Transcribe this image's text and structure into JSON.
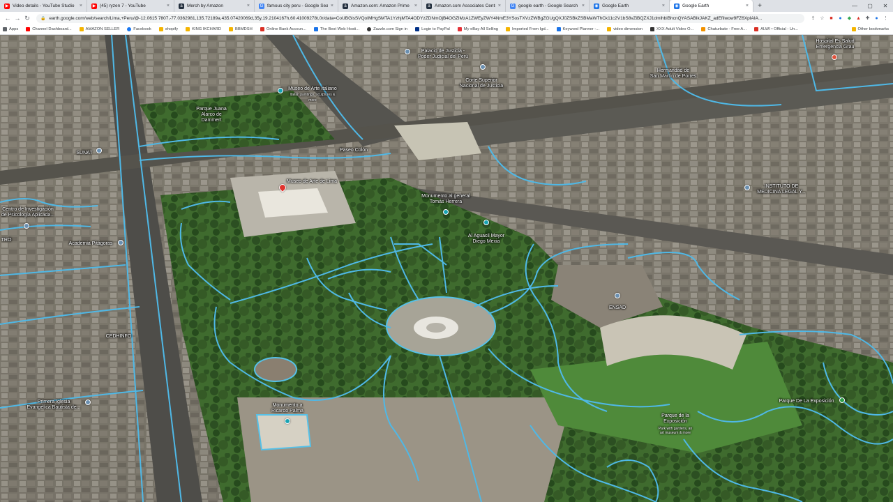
{
  "tabs": [
    {
      "title": "Video details - YouTube Studio",
      "color": "#ff0000",
      "glyph": "▶",
      "active": false
    },
    {
      "title": "(45) ryzen 7 - YouTube",
      "color": "#ff0000",
      "glyph": "▶",
      "active": false
    },
    {
      "title": "Merch by Amazon",
      "color": "#232f3e",
      "glyph": "a",
      "active": false
    },
    {
      "title": "famous city peru - Google Search",
      "color": "#4285f4",
      "glyph": "G",
      "active": false
    },
    {
      "title": "Amazon.com: Amazon Prime",
      "color": "#232f3e",
      "glyph": "a",
      "active": false
    },
    {
      "title": "Amazon.com Associates Central",
      "color": "#232f3e",
      "glyph": "a",
      "active": false
    },
    {
      "title": "google earth - Google Search",
      "color": "#4285f4",
      "glyph": "G",
      "active": false
    },
    {
      "title": "Google Earth",
      "color": "#1a73e8",
      "glyph": "◉",
      "active": false
    },
    {
      "title": "Google Earth",
      "color": "#1a73e8",
      "glyph": "◉",
      "active": true
    }
  ],
  "toolbar": {
    "back_icon": "back-arrow-icon",
    "forward_icon": "forward-arrow-icon",
    "reload_icon": "reload-icon",
    "url": "earth.google.com/web/search/Lima,+Peru/@-12.0615 7807,-77.0362981,135.72189a,435.07420069d,35y,19.2104167h,60.41009278t,0r/data=CoUBGlsSVQoIMHgSMTA1YzhjMTA4ODYzZDNmOjB4OGZlMzA1ZWEyZWY4NmE3YSosTXVzZWBgZGUgQXJ0ZSBkZSBMaWThCk11c2V1bS8vZiBQZXJ1dmlhbiBhcnQYASABIkJAKZ_adEfliwow9FZ6XpIAIA..."
  },
  "bookmarks": [
    {
      "label": "Apps",
      "color": "#5f6368"
    },
    {
      "label": "Channel Dashboard...",
      "color": "#ff0000"
    },
    {
      "label": "AMAZON SELLER",
      "color": "#f4b400"
    },
    {
      "label": "Facebook",
      "color": "#1877f2"
    },
    {
      "label": "shopify",
      "color": "#f4b400"
    },
    {
      "label": "KING IKCHARD",
      "color": "#f4b400"
    },
    {
      "label": "BBMDSH",
      "color": "#f4b400"
    },
    {
      "label": "Online Bank Accoun...",
      "color": "#d93025"
    },
    {
      "label": "The Best Web Hosti...",
      "color": "#1a73e8"
    },
    {
      "label": "Zazzle.com Sign in",
      "color": "#333333"
    },
    {
      "label": "Login to PayPal",
      "color": "#003087"
    },
    {
      "label": "My eBay All Selling",
      "color": "#e53238"
    },
    {
      "label": "Imported From Igd...",
      "color": "#f4b400"
    },
    {
      "label": "Keyword Planner -...",
      "color": "#1a73e8"
    },
    {
      "label": "video dimension",
      "color": "#f4b400"
    },
    {
      "label": "XXX Adult Video O...",
      "color": "#333333"
    },
    {
      "label": "Chaturbate - Free A...",
      "color": "#f29200"
    },
    {
      "label": "ALWI • Official - Un...",
      "color": "#d93025"
    },
    {
      "label": "Other bookmarks",
      "color": "#f4b400"
    }
  ],
  "map": {
    "labels": [
      {
        "text": "Palacio de Justicia -",
        "sub": "Poder Judicial del Perú",
        "icon": "landmark-icon"
      },
      {
        "text": "Corte Superior",
        "sub": "Nacional de Justicia",
        "icon": "landmark-icon"
      },
      {
        "text": "Hospital Es Salud",
        "sub": "Emergencia Grau",
        "icon": "hospital-icon"
      },
      {
        "text": "Hermandad de",
        "sub": "San Martín de Porres",
        "icon": ""
      },
      {
        "text": "Museo de Arte Italiano",
        "sub": "Italian paintings, sculptures & more",
        "icon": "museum-icon"
      },
      {
        "text": "Parque Juana",
        "sub": "Alarco de Dammert",
        "icon": ""
      },
      {
        "text": "SUNAT",
        "sub": "",
        "icon": "building-icon"
      },
      {
        "text": "Paseo Colón",
        "sub": "",
        "icon": ""
      },
      {
        "text": "Museo de Arte de Lima",
        "sub": "",
        "icon": "selected-pin-icon"
      },
      {
        "text": "Monumento al general",
        "sub": "Tomás Herrera",
        "icon": "monument-icon"
      },
      {
        "text": "Al Aguacil Mayor",
        "sub": "Diego Mexia",
        "icon": "monument-icon"
      },
      {
        "text": "INSTITUTO DE",
        "sub": "MEDICINA LEGAL Y...",
        "icon": "building-icon"
      },
      {
        "text": "Centro de Investigación",
        "sub": "de Psicología Aplicada...",
        "icon": "building-icon"
      },
      {
        "text": "TRO",
        "sub": "",
        "icon": ""
      },
      {
        "text": "Academia Pitágoras",
        "sub": "",
        "icon": "building-icon"
      },
      {
        "text": "ENSAD",
        "sub": "",
        "icon": "building-icon"
      },
      {
        "text": "CEDHINFO",
        "sub": "",
        "icon": ""
      },
      {
        "text": "Primera Iglesia",
        "sub": "Evangélica Bautista de...",
        "icon": "church-icon"
      },
      {
        "text": "Monumento a",
        "sub": "Ricardo Palma",
        "icon": "monument-icon"
      },
      {
        "text": "Parque De La Exposición",
        "sub": "",
        "icon": "park-icon"
      },
      {
        "text": "Parque de la",
        "sub": "Exposición",
        "icon": "park-icon"
      },
      {
        "text": "Park with gardens, an art museum & more",
        "sub": "",
        "icon": ""
      }
    ]
  }
}
